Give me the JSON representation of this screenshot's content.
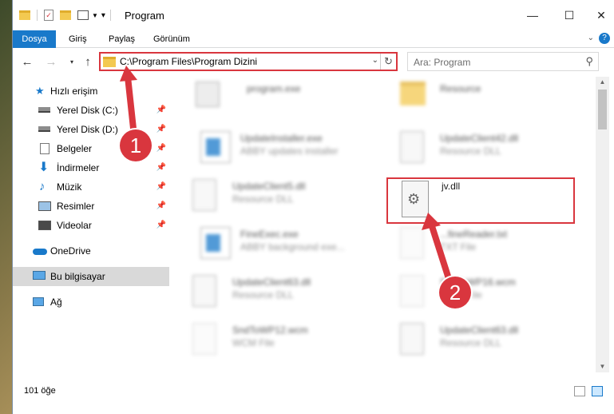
{
  "window": {
    "title": "Program"
  },
  "window_buttons": {
    "minimize": "—",
    "maximize": "☐",
    "close": "✕"
  },
  "ribbon": {
    "tabs": [
      "Dosya",
      "Giriş",
      "Paylaş",
      "Görünüm"
    ]
  },
  "address": {
    "path": "C:\\Program Files\\Program Dizini"
  },
  "search": {
    "placeholder": "Ara: Program"
  },
  "nav": {
    "items": [
      {
        "label": "Hızlı erişim",
        "icon": "star-icon",
        "pinned": false
      },
      {
        "label": "Yerel Disk (C:)",
        "icon": "drive-icon",
        "pinned": true
      },
      {
        "label": "Yerel Disk (D:)",
        "icon": "drive-icon",
        "pinned": true
      },
      {
        "label": "Belgeler",
        "icon": "documents-icon",
        "pinned": true
      },
      {
        "label": "İndirmeler",
        "icon": "downloads-icon",
        "pinned": true
      },
      {
        "label": "Müzik",
        "icon": "music-icon",
        "pinned": true
      },
      {
        "label": "Resimler",
        "icon": "pictures-icon",
        "pinned": true
      },
      {
        "label": "Videolar",
        "icon": "videos-icon",
        "pinned": true
      },
      {
        "label": "OneDrive",
        "icon": "cloud-icon",
        "pinned": false
      },
      {
        "label": "Bu bilgisayar",
        "icon": "computer-icon",
        "pinned": false
      },
      {
        "label": "Ağ",
        "icon": "network-icon",
        "pinned": false
      }
    ]
  },
  "files": [
    {
      "name": "program.exe",
      "desc": "",
      "icon": "exe-icon"
    },
    {
      "name": "Resource",
      "desc": "",
      "icon": "folder-icon"
    },
    {
      "name": "UpdateInstaller.exe",
      "desc": "ABBY updates installer",
      "icon": "app-window-icon"
    },
    {
      "name": "UpdateClient42.dll",
      "desc": "Resource DLL",
      "icon": "dll-icon"
    },
    {
      "name": "UpdateClient5.dll",
      "desc": "Resource DLL",
      "icon": "dll-icon"
    },
    {
      "name": "jv.dll",
      "desc": "",
      "icon": "dll-icon"
    },
    {
      "name": "FineExec.exe",
      "desc": "ABBY background exe...",
      "icon": "app-window-icon"
    },
    {
      "name": "...fineReader.txt",
      "desc": "TXT File",
      "icon": "text-file-icon"
    },
    {
      "name": "UpdateClient63.dll",
      "desc": "Resource DLL",
      "icon": "dll-icon"
    },
    {
      "name": "SndToWP16.wcm",
      "desc": "WCM File",
      "icon": "blank-file-icon"
    },
    {
      "name": "SndToWP12.wcm",
      "desc": "WCM File",
      "icon": "blank-file-icon"
    },
    {
      "name": "UpdateClient63.dll",
      "desc": "Resource DLL",
      "icon": "dll-icon"
    }
  ],
  "status": {
    "count": "101 öğe"
  },
  "callouts": [
    "1",
    "2"
  ],
  "colors": {
    "accent": "#1979ca",
    "highlight": "#d9363e"
  }
}
